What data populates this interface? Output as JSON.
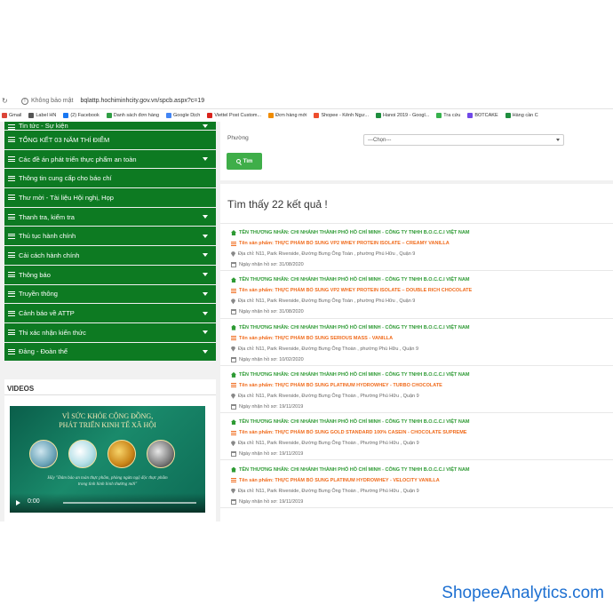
{
  "browser": {
    "security_label": "Không bảo mật",
    "url": "bqlattp.hochiminhcity.gov.vn/spcb.aspx?c=19",
    "bookmarks": [
      {
        "label": "Gmail",
        "color": "#db4437"
      },
      {
        "label": "Label HN",
        "color": "#555555"
      },
      {
        "label": "(2) Facebook",
        "color": "#1877f2"
      },
      {
        "label": "Danh sách đơn hàng",
        "color": "#2f9e44"
      },
      {
        "label": "Google Dịch",
        "color": "#4285f4"
      },
      {
        "label": "Viettel Post Custom...",
        "color": "#d9231c"
      },
      {
        "label": "Đơn hàng mới",
        "color": "#f08c00"
      },
      {
        "label": "Shopee - Kênh Ngư...",
        "color": "#ee4d2d"
      },
      {
        "label": "Hanoi 2019 - Googl...",
        "color": "#1e8e3e"
      },
      {
        "label": "Tra cứu",
        "color": "#37b24d"
      },
      {
        "label": "BOTCAKE",
        "color": "#7048e8"
      },
      {
        "label": "Hàng cần C",
        "color": "#1e8e3e"
      }
    ]
  },
  "sidebar": {
    "menu": [
      {
        "label": "Tin tức - Sự kiện",
        "caret": true
      },
      {
        "label": "TỔNG KẾT 03 NĂM THÍ ĐIỂM",
        "caret": false
      },
      {
        "label": "Các đề án phát triển thực phẩm an toàn",
        "caret": true
      },
      {
        "label": "Thông tin cung cấp cho báo chí",
        "caret": false
      },
      {
        "label": "Thư mời - Tài liệu Hội nghị, Họp",
        "caret": false
      },
      {
        "label": "Thanh tra, kiểm tra",
        "caret": true
      },
      {
        "label": "Thủ tục hành chính",
        "caret": true
      },
      {
        "label": "Cải cách hành chính",
        "caret": true
      },
      {
        "label": "Thông báo",
        "caret": true
      },
      {
        "label": "Truyền thông",
        "caret": true
      },
      {
        "label": "Cảnh báo về ATTP",
        "caret": true
      },
      {
        "label": "Thi xác nhận kiến thức",
        "caret": true
      },
      {
        "label": "Đảng - Đoàn thể",
        "caret": true
      }
    ],
    "videos": {
      "title": "VIDEOS",
      "headline_1": "VÌ SỨC KHỎE CỘNG ĐỒNG,",
      "headline_2": "PHÁT TRIỂN KINH TẾ XÃ HỘI",
      "quote_1": "Hãy \"Đảm bảo an toàn thực phẩm, phòng ngừa ngộ độc thực phẩm",
      "quote_2": "trong tình hình bình thường mới\"",
      "time": "0:00"
    }
  },
  "filter": {
    "ward_label": "Phường",
    "ward_select": "---Chọn---",
    "search_label": "Tìm"
  },
  "results": {
    "count_text": "Tìm thấy 22 kết quả !",
    "items": [
      {
        "trader": "TÊN THƯƠNG NHÂN: CHI NHÁNH THÀNH PHỐ HỒ CHÍ MINH - CÔNG TY TNHH B.O.C.C.I VIỆT NAM",
        "product": "Tên sản phẩm: THỰC PHẨM BỔ SUNG VP2 WHEY PROTEIN ISOLATE – CREAMY VANILLA",
        "address": "Địa chỉ: N11, Park Riverside, Đường Bưng Ông Toàn , phường Phú Hữu , Quận 9",
        "date": "Ngày nhận hồ sơ: 31/08/2020"
      },
      {
        "trader": "TÊN THƯƠNG NHÂN: CHI NHÁNH THÀNH PHỐ HỒ CHÍ MINH - CÔNG TY TNHH B.O.C.C.I VIỆT NAM",
        "product": "Tên sản phẩm: THỰC PHẨM BỔ SUNG VP2 WHEY PROTEIN ISOLATE – DOUBLE RICH CHOCOLATE",
        "address": "Địa chỉ: N11, Park Riverside, Đường Bưng Ông Toàn , phường Phú Hữu , Quận 9",
        "date": "Ngày nhận hồ sơ: 31/08/2020"
      },
      {
        "trader": "TÊN THƯƠNG NHÂN: CHI NHÁNH THÀNH PHỐ HỒ CHÍ MINH - CÔNG TY TNHH B.O.C.C.I VIỆT NAM",
        "product": "Tên sản phẩm: THỰC PHẨM BỔ SUNG SERIOUS MASS - VANILLA",
        "address": "Địa chỉ: N11, Park Riverside, Đường Bưng Ông Thoàn , phường Phú Hữu , Quận 9",
        "date": "Ngày nhận hồ sơ: 10/02/2020"
      },
      {
        "trader": "TÊN THƯƠNG NHÂN: CHI NHÁNH THÀNH PHỐ HỒ CHÍ MINH - CÔNG TY TNHH B.O.C.C.I VIỆT NAM",
        "product": "Tên sản phẩm: THỰC PHẨM BỔ SUNG PLATINUM HYDROWHEY - TURBO CHOCOLATE",
        "address": "Địa chỉ: N11, Park Riverside, Đường Bưng Ông Thoàn , Phường Phú Hữu , Quận 9",
        "date": "Ngày nhận hồ sơ: 19/11/2019"
      },
      {
        "trader": "TÊN THƯƠNG NHÂN: CHI NHÁNH THÀNH PHỐ HỒ CHÍ MINH - CÔNG TY TNHH B.O.C.C.I VIỆT NAM",
        "product": "Tên sản phẩm: THỰC PHẨM BỔ SUNG GOLD STANDARD 100% CASEIN - CHOCOLATE SUPREME",
        "address": "Địa chỉ: N11, Park Riverside, Đường Bưng Ông Thoàn , Phường Phú Hữu , Quận 9",
        "date": "Ngày nhận hồ sơ: 19/11/2019"
      },
      {
        "trader": "TÊN THƯƠNG NHÂN: CHI NHÁNH THÀNH PHỐ HỒ CHÍ MINH - CÔNG TY TNHH B.O.C.C.I VIỆT NAM",
        "product": "Tên sản phẩm: THỰC PHẨM BỔ SUNG PLATINUM HYDROWHEY - VELOCITY VANILLA",
        "address": "Địa chỉ: N11, Park Riverside, Đường Bưng Ông Thoàn , Phường Phú Hữu , Quận 9",
        "date": "Ngày nhận hồ sơ: 19/11/2019"
      }
    ]
  },
  "watermark": "ShopeeAnalytics.com",
  "colors": {
    "menu_green": "#0d7a22",
    "trader_green": "#2d9a33",
    "product_orange": "#f06b1c",
    "button_green": "#3fae49",
    "watermark_blue": "#1c6fd1"
  }
}
